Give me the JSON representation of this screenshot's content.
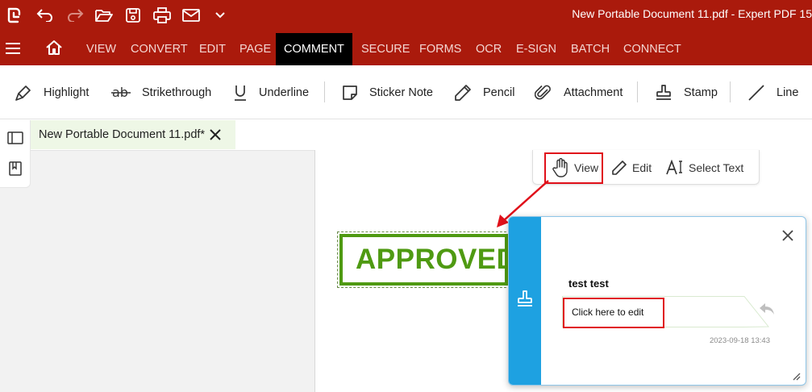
{
  "window": {
    "title": "New Portable Document 11.pdf   -   Expert PDF 15",
    "quick_access": [
      "app-logo-icon",
      "undo-icon",
      "redo-icon",
      "open-folder-icon",
      "save-icon",
      "print-icon",
      "email-icon",
      "chevron-down-icon"
    ]
  },
  "menu": {
    "items": [
      "VIEW",
      "CONVERT",
      "EDIT",
      "PAGE",
      "COMMENT",
      "SECURE",
      "FORMS",
      "OCR",
      "E-SIGN",
      "BATCH",
      "CONNECT"
    ],
    "active": "COMMENT"
  },
  "ribbon": {
    "highlight": "Highlight",
    "strikethrough": "Strikethrough",
    "underline": "Underline",
    "sticker_note": "Sticker Note",
    "pencil": "Pencil",
    "attachment": "Attachment",
    "stamp": "Stamp",
    "line": "Line"
  },
  "document_tab": {
    "name": "New Portable Document 11.pdf*"
  },
  "mode_toolbar": {
    "view": "View",
    "edit": "Edit",
    "select_text": "Select Text"
  },
  "stamp": {
    "text": "APPROVED",
    "color": "#4f9a12"
  },
  "comment_popup": {
    "author": "test test",
    "edit_placeholder": "Click here to edit",
    "timestamp": "2023-09-18 13:43",
    "accent_color": "#1ea1e1"
  },
  "colors": {
    "title_bar": "#aa1a0c",
    "active_tab": "#000000",
    "highlight_box": "#e0101a",
    "doc_tab_bg": "#eef7e6"
  }
}
